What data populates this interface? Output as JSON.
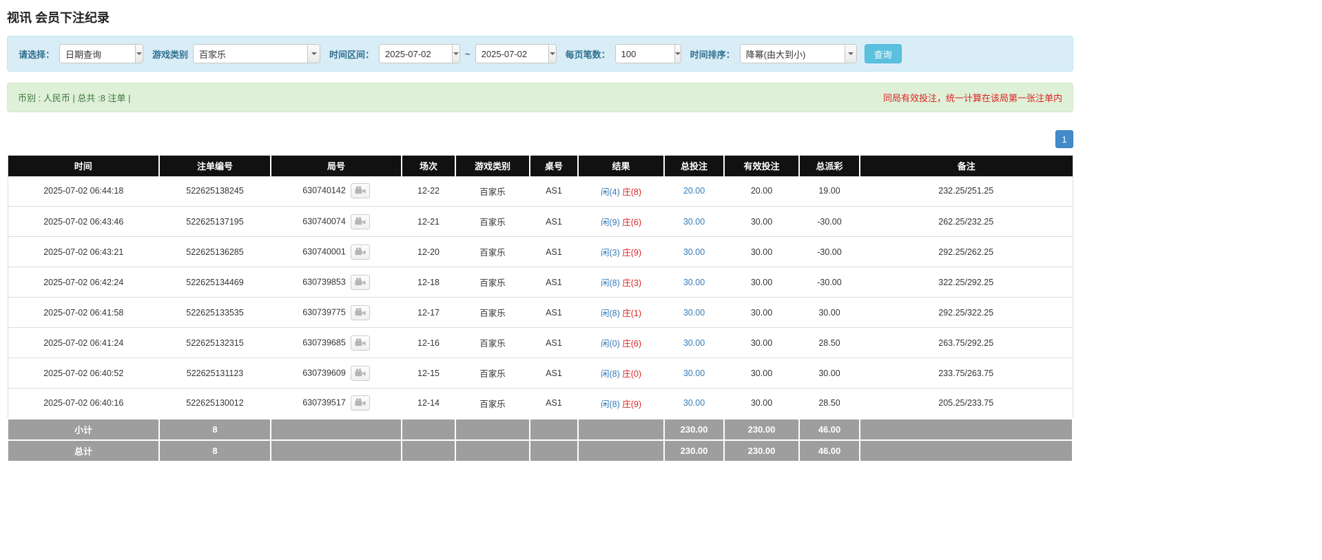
{
  "page": {
    "title": "视讯 会员下注纪录"
  },
  "filters": {
    "select_label": "请选择：",
    "select_value": "日期查询",
    "game_type_label": "游戏类别",
    "game_type_value": "百家乐",
    "date_range_label": "时间区间：",
    "date_from": "2025-07-02",
    "date_separator": "~",
    "date_to": "2025-07-02",
    "page_size_label": "每页笔数：",
    "page_size_value": "100",
    "sort_label": "时间排序：",
    "sort_value": "降幂(由大到小)",
    "search_button": "查询"
  },
  "summary": {
    "left": "币别 : 人民币 | 总共 :8 注单 |",
    "right": "同局有效投注，统一计算在该局第一张注单内"
  },
  "pagination": {
    "current": "1"
  },
  "colors": {
    "player_blue": "#337ab7",
    "banker_red": "#dd2222",
    "negative_red": "#dd2222",
    "link_blue": "#337ab7",
    "header_black": "#111111",
    "footer_gray": "#9e9e9e",
    "filter_bar_blue": "#d9edf7",
    "summary_bar_green": "#dff0d8",
    "search_button_blue": "#5bc0de",
    "pagination_blue": "#428bca"
  },
  "icons": {
    "combo_arrow": "chevron-down-icon",
    "video_replay": "video-camera-icon"
  },
  "table": {
    "headers": [
      "时间",
      "注单编号",
      "局号",
      "场次",
      "游戏类别",
      "桌号",
      "结果",
      "总投注",
      "有效投注",
      "总派彩",
      "备注"
    ],
    "rows": [
      {
        "time": "2025-07-02 06:44:18",
        "bet_id": "522625138245",
        "round": "630740142",
        "session": "12-22",
        "game": "百家乐",
        "table_no": "AS1",
        "result_player": "闲(4)",
        "result_banker": "庄(8)",
        "total_bet": "20.00",
        "valid_bet": "20.00",
        "payout": "19.00",
        "remark": "232.25/251.25"
      },
      {
        "time": "2025-07-02 06:43:46",
        "bet_id": "522625137195",
        "round": "630740074",
        "session": "12-21",
        "game": "百家乐",
        "table_no": "AS1",
        "result_player": "闲(9)",
        "result_banker": "庄(6)",
        "total_bet": "30.00",
        "valid_bet": "30.00",
        "payout": "-30.00",
        "remark": "262.25/232.25"
      },
      {
        "time": "2025-07-02 06:43:21",
        "bet_id": "522625136285",
        "round": "630740001",
        "session": "12-20",
        "game": "百家乐",
        "table_no": "AS1",
        "result_player": "闲(3)",
        "result_banker": "庄(9)",
        "total_bet": "30.00",
        "valid_bet": "30.00",
        "payout": "-30.00",
        "remark": "292.25/262.25"
      },
      {
        "time": "2025-07-02 06:42:24",
        "bet_id": "522625134469",
        "round": "630739853",
        "session": "12-18",
        "game": "百家乐",
        "table_no": "AS1",
        "result_player": "闲(8)",
        "result_banker": "庄(3)",
        "total_bet": "30.00",
        "valid_bet": "30.00",
        "payout": "-30.00",
        "remark": "322.25/292.25"
      },
      {
        "time": "2025-07-02 06:41:58",
        "bet_id": "522625133535",
        "round": "630739775",
        "session": "12-17",
        "game": "百家乐",
        "table_no": "AS1",
        "result_player": "闲(8)",
        "result_banker": "庄(1)",
        "total_bet": "30.00",
        "valid_bet": "30.00",
        "payout": "30.00",
        "remark": "292.25/322.25"
      },
      {
        "time": "2025-07-02 06:41:24",
        "bet_id": "522625132315",
        "round": "630739685",
        "session": "12-16",
        "game": "百家乐",
        "table_no": "AS1",
        "result_player": "闲(0)",
        "result_banker": "庄(6)",
        "total_bet": "30.00",
        "valid_bet": "30.00",
        "payout": "28.50",
        "remark": "263.75/292.25"
      },
      {
        "time": "2025-07-02 06:40:52",
        "bet_id": "522625131123",
        "round": "630739609",
        "session": "12-15",
        "game": "百家乐",
        "table_no": "AS1",
        "result_player": "闲(8)",
        "result_banker": "庄(0)",
        "total_bet": "30.00",
        "valid_bet": "30.00",
        "payout": "30.00",
        "remark": "233.75/263.75"
      },
      {
        "time": "2025-07-02 06:40:16",
        "bet_id": "522625130012",
        "round": "630739517",
        "session": "12-14",
        "game": "百家乐",
        "table_no": "AS1",
        "result_player": "闲(8)",
        "result_banker": "庄(9)",
        "total_bet": "30.00",
        "valid_bet": "30.00",
        "payout": "28.50",
        "remark": "205.25/233.75"
      }
    ],
    "subtotal": {
      "label": "小计",
      "count": "8",
      "total_bet": "230.00",
      "valid_bet": "230.00",
      "payout": "46.00"
    },
    "total": {
      "label": "总计",
      "count": "8",
      "total_bet": "230.00",
      "valid_bet": "230.00",
      "payout": "46.00"
    }
  }
}
